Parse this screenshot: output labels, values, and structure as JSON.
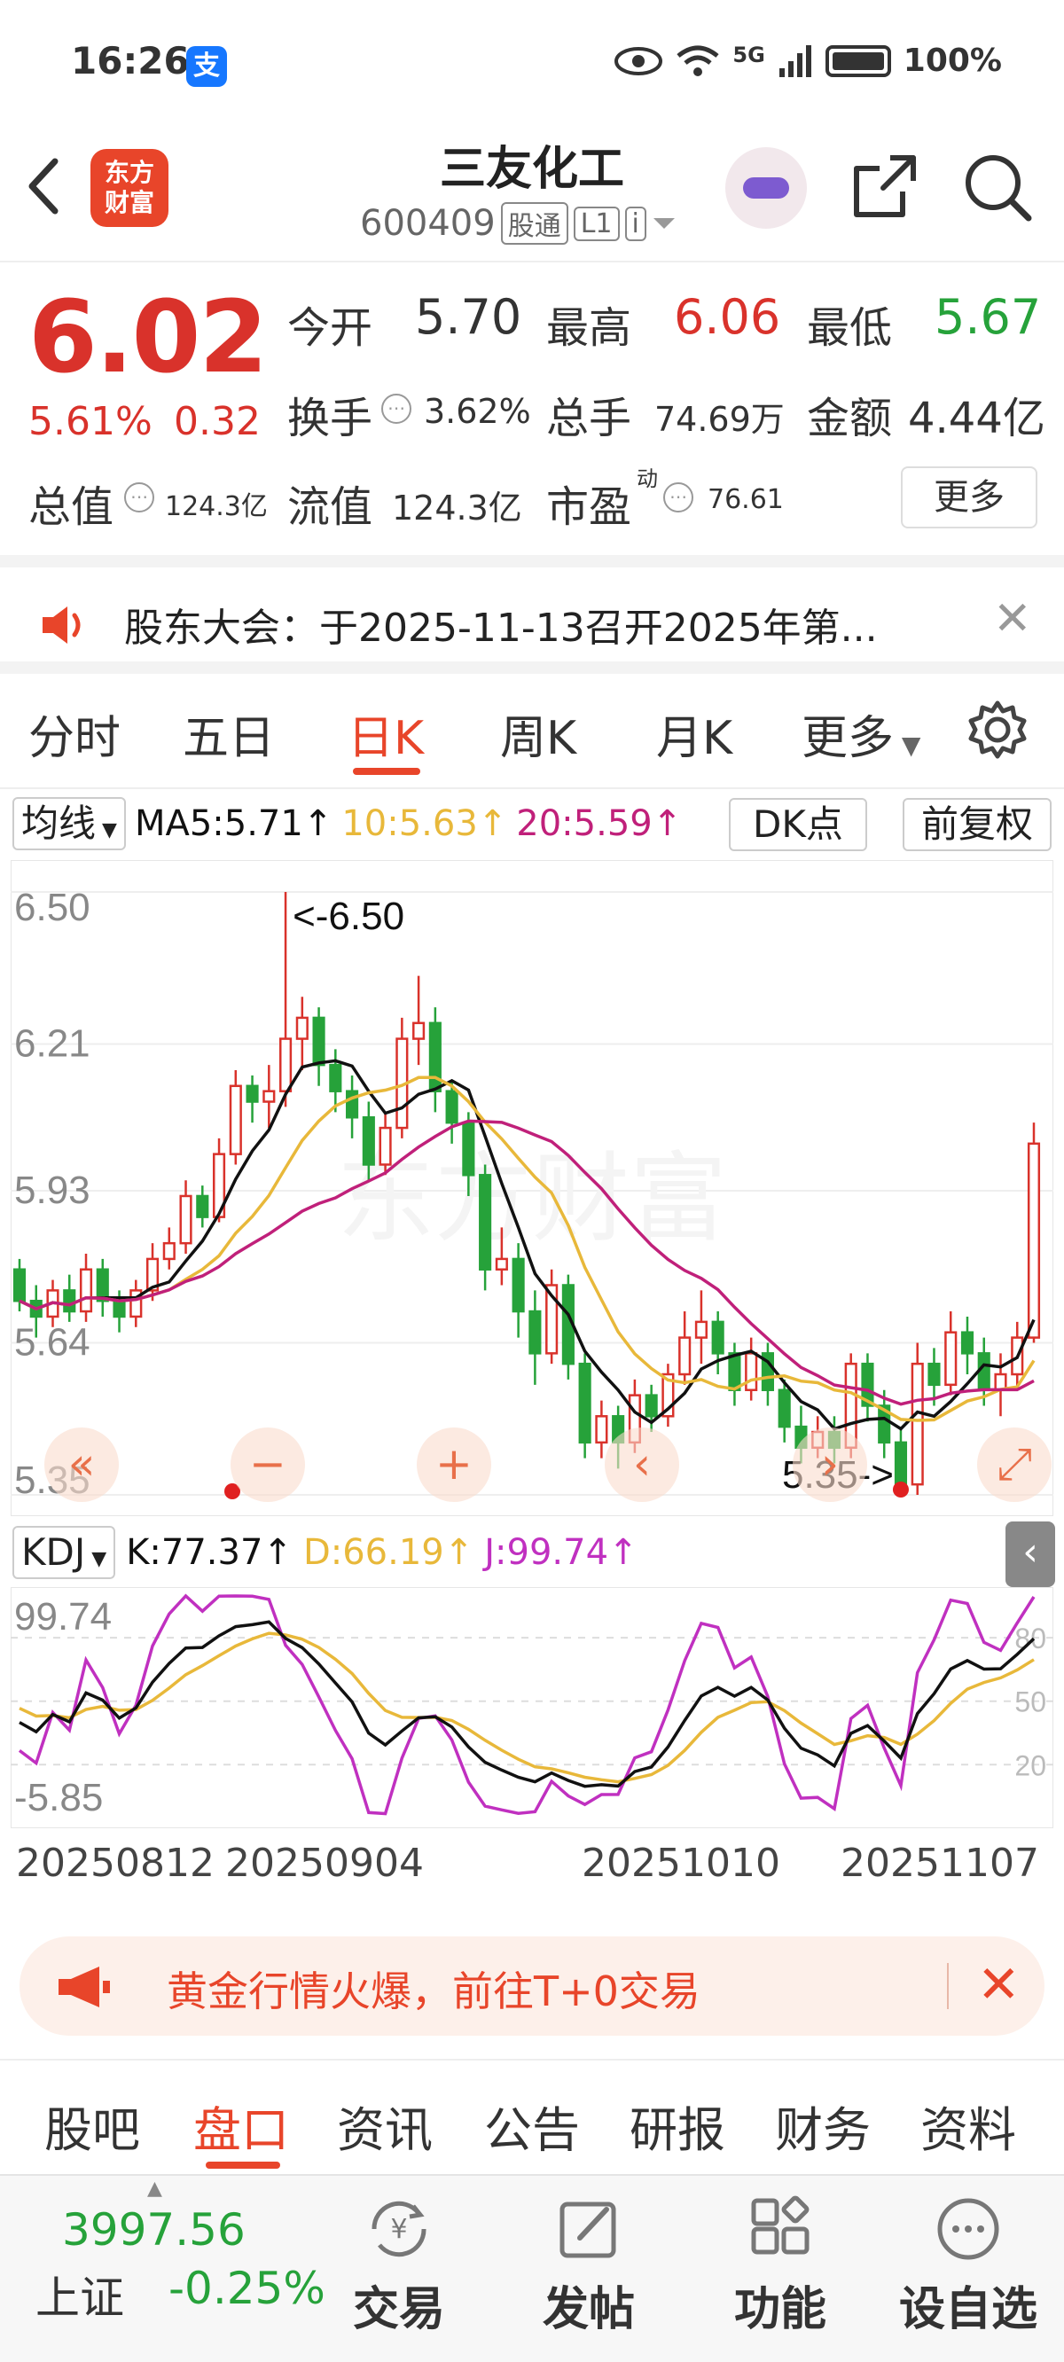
{
  "status": {
    "time": "16:26",
    "alipay": "支",
    "network": "5G",
    "battery": "100%"
  },
  "header": {
    "logo": [
      "东方",
      "财富"
    ],
    "name": "三友化工",
    "code": "600409",
    "tag1": "股通",
    "tag2": "L1",
    "tag3": "i"
  },
  "quote": {
    "price": "6.02",
    "change_pct": "5.61%",
    "change": "0.32",
    "open_label": "今开",
    "open": "5.70",
    "high_label": "最高",
    "high": "6.06",
    "low_label": "最低",
    "low": "5.67",
    "turnover_label": "换手",
    "turnover": "3.62%",
    "volume_label": "总手",
    "volume": "74.69万",
    "amount_label": "金额",
    "amount": "4.44亿",
    "mcap_label": "总值",
    "mcap": "124.3亿",
    "float_label": "流值",
    "float": "124.3亿",
    "pe_label": "市盈",
    "pe_sup": "动",
    "pe": "76.61",
    "more": "更多"
  },
  "notice": {
    "text": "股东大会：于2025-11-13召开2025年第..."
  },
  "tabs": {
    "items": [
      "分时",
      "五日",
      "日K",
      "周K",
      "月K",
      "更多"
    ],
    "active": "日K"
  },
  "ma": {
    "selector": "均线",
    "ma5": "MA5:5.71↑",
    "ma10": "10:5.63↑",
    "ma20": "20:5.59↑",
    "dk": "DK点",
    "adjust": "前复权"
  },
  "kdj": {
    "selector": "KDJ",
    "k": "K:77.37↑",
    "d": "D:66.19↑",
    "j": "J:99.74↑"
  },
  "colors": {
    "up": "#d9322b",
    "down": "#26a23a",
    "ma5": "#111111",
    "ma10": "#e8b83a",
    "ma20": "#c0207a",
    "accent": "#e8452a"
  },
  "chart_data": {
    "type": "candlestick",
    "y_ticks": [
      "6.50",
      "6.21",
      "5.93",
      "5.64",
      "5.35"
    ],
    "ylim": [
      5.35,
      6.5
    ],
    "max_label": "<-6.50",
    "min_label": "5.35->",
    "dates": [
      "20250812",
      "20250904",
      "20251010",
      "20251107"
    ],
    "candles": [
      [
        5.78,
        5.72,
        5.8,
        5.7
      ],
      [
        5.72,
        5.69,
        5.75,
        5.65
      ],
      [
        5.69,
        5.74,
        5.76,
        5.67
      ],
      [
        5.74,
        5.7,
        5.77,
        5.68
      ],
      [
        5.7,
        5.78,
        5.81,
        5.68
      ],
      [
        5.78,
        5.72,
        5.8,
        5.69
      ],
      [
        5.72,
        5.69,
        5.74,
        5.66
      ],
      [
        5.69,
        5.74,
        5.76,
        5.67
      ],
      [
        5.74,
        5.8,
        5.83,
        5.72
      ],
      [
        5.8,
        5.83,
        5.86,
        5.78
      ],
      [
        5.83,
        5.92,
        5.95,
        5.81
      ],
      [
        5.92,
        5.88,
        5.94,
        5.86
      ],
      [
        5.88,
        6.0,
        6.03,
        5.87
      ],
      [
        6.0,
        6.13,
        6.16,
        5.98
      ],
      [
        6.13,
        6.1,
        6.15,
        6.06
      ],
      [
        6.1,
        6.12,
        6.17,
        6.05
      ],
      [
        6.12,
        6.22,
        6.5,
        6.09
      ],
      [
        6.22,
        6.26,
        6.3,
        6.16
      ],
      [
        6.26,
        6.17,
        6.28,
        6.13
      ],
      [
        6.17,
        6.12,
        6.2,
        6.08
      ],
      [
        6.12,
        6.07,
        6.15,
        6.03
      ],
      [
        6.07,
        5.98,
        6.1,
        5.95
      ],
      [
        5.98,
        6.05,
        6.08,
        5.96
      ],
      [
        6.05,
        6.22,
        6.26,
        6.03
      ],
      [
        6.22,
        6.25,
        6.34,
        6.17
      ],
      [
        6.25,
        6.12,
        6.28,
        6.08
      ],
      [
        6.12,
        6.06,
        6.14,
        6.02
      ],
      [
        6.06,
        5.96,
        6.08,
        5.92
      ],
      [
        5.96,
        5.78,
        5.98,
        5.74
      ],
      [
        5.78,
        5.8,
        5.86,
        5.75
      ],
      [
        5.8,
        5.7,
        5.83,
        5.65
      ],
      [
        5.7,
        5.62,
        5.74,
        5.56
      ],
      [
        5.62,
        5.75,
        5.78,
        5.6
      ],
      [
        5.75,
        5.6,
        5.77,
        5.57
      ],
      [
        5.6,
        5.45,
        5.62,
        5.42
      ],
      [
        5.45,
        5.5,
        5.53,
        5.42
      ],
      [
        5.5,
        5.45,
        5.52,
        5.4
      ],
      [
        5.45,
        5.54,
        5.57,
        5.43
      ],
      [
        5.54,
        5.5,
        5.56,
        5.47
      ],
      [
        5.5,
        5.58,
        5.6,
        5.48
      ],
      [
        5.58,
        5.65,
        5.7,
        5.56
      ],
      [
        5.65,
        5.68,
        5.74,
        5.6
      ],
      [
        5.68,
        5.62,
        5.7,
        5.58
      ],
      [
        5.62,
        5.55,
        5.64,
        5.52
      ],
      [
        5.55,
        5.62,
        5.65,
        5.53
      ],
      [
        5.62,
        5.55,
        5.64,
        5.52
      ],
      [
        5.55,
        5.48,
        5.57,
        5.45
      ],
      [
        5.48,
        5.44,
        5.52,
        5.41
      ],
      [
        5.44,
        5.47,
        5.5,
        5.42
      ],
      [
        5.47,
        5.44,
        5.5,
        5.41
      ],
      [
        5.44,
        5.6,
        5.62,
        5.42
      ],
      [
        5.6,
        5.52,
        5.62,
        5.49
      ],
      [
        5.52,
        5.45,
        5.55,
        5.42
      ],
      [
        5.45,
        5.37,
        5.48,
        5.35
      ],
      [
        5.37,
        5.6,
        5.64,
        5.35
      ],
      [
        5.6,
        5.56,
        5.63,
        5.52
      ],
      [
        5.56,
        5.66,
        5.7,
        5.54
      ],
      [
        5.66,
        5.62,
        5.69,
        5.58
      ],
      [
        5.62,
        5.55,
        5.65,
        5.52
      ],
      [
        5.55,
        5.58,
        5.62,
        5.5
      ],
      [
        5.58,
        5.65,
        5.68,
        5.55
      ],
      [
        5.65,
        6.02,
        6.06,
        5.64
      ]
    ]
  }
}
